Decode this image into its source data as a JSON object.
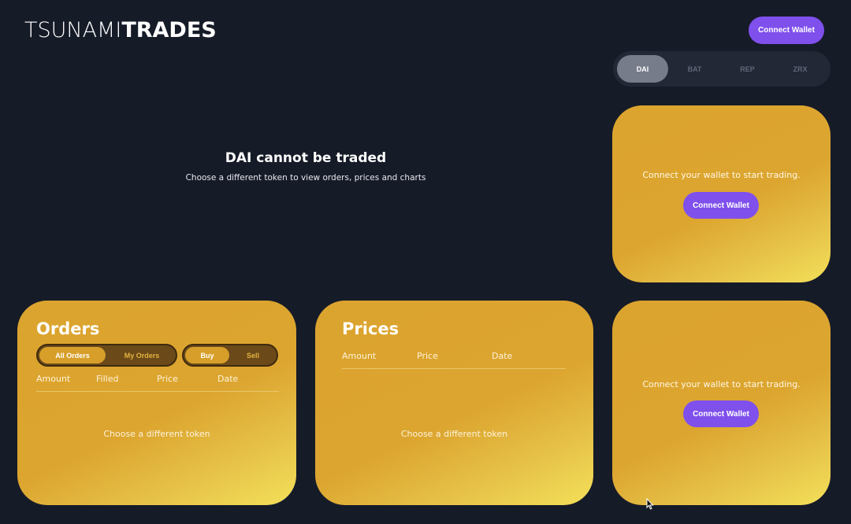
{
  "header": {
    "logo_light": "TSUNAMI",
    "logo_bold": "TRADES",
    "connect_label": "Connect Wallet"
  },
  "tokens": [
    {
      "label": "DAI",
      "active": true
    },
    {
      "label": "BAT",
      "active": false
    },
    {
      "label": "REP",
      "active": false
    },
    {
      "label": "ZRX",
      "active": false
    }
  ],
  "notice": {
    "title": "DAI cannot be traded",
    "subtitle": "Choose a different token to view orders, prices and charts"
  },
  "trade_panel": {
    "message": "Connect your wallet to start trading.",
    "button_label": "Connect Wallet"
  },
  "orders": {
    "title": "Orders",
    "filter_tabs": [
      "All Orders",
      "My Orders"
    ],
    "side_tabs": [
      "Buy",
      "Sell"
    ],
    "columns": [
      "Amount",
      "Filled",
      "Price",
      "Date"
    ],
    "empty": "Choose a different token"
  },
  "prices": {
    "title": "Prices",
    "columns": [
      "Amount",
      "Price",
      "Date"
    ],
    "empty": "Choose a different token"
  },
  "wallet_panel": {
    "message": "Connect your wallet to start trading.",
    "button_label": "Connect Wallet"
  },
  "colors": {
    "background": "#161b28",
    "accent": "#7f50ec",
    "card": "#dca52f"
  }
}
